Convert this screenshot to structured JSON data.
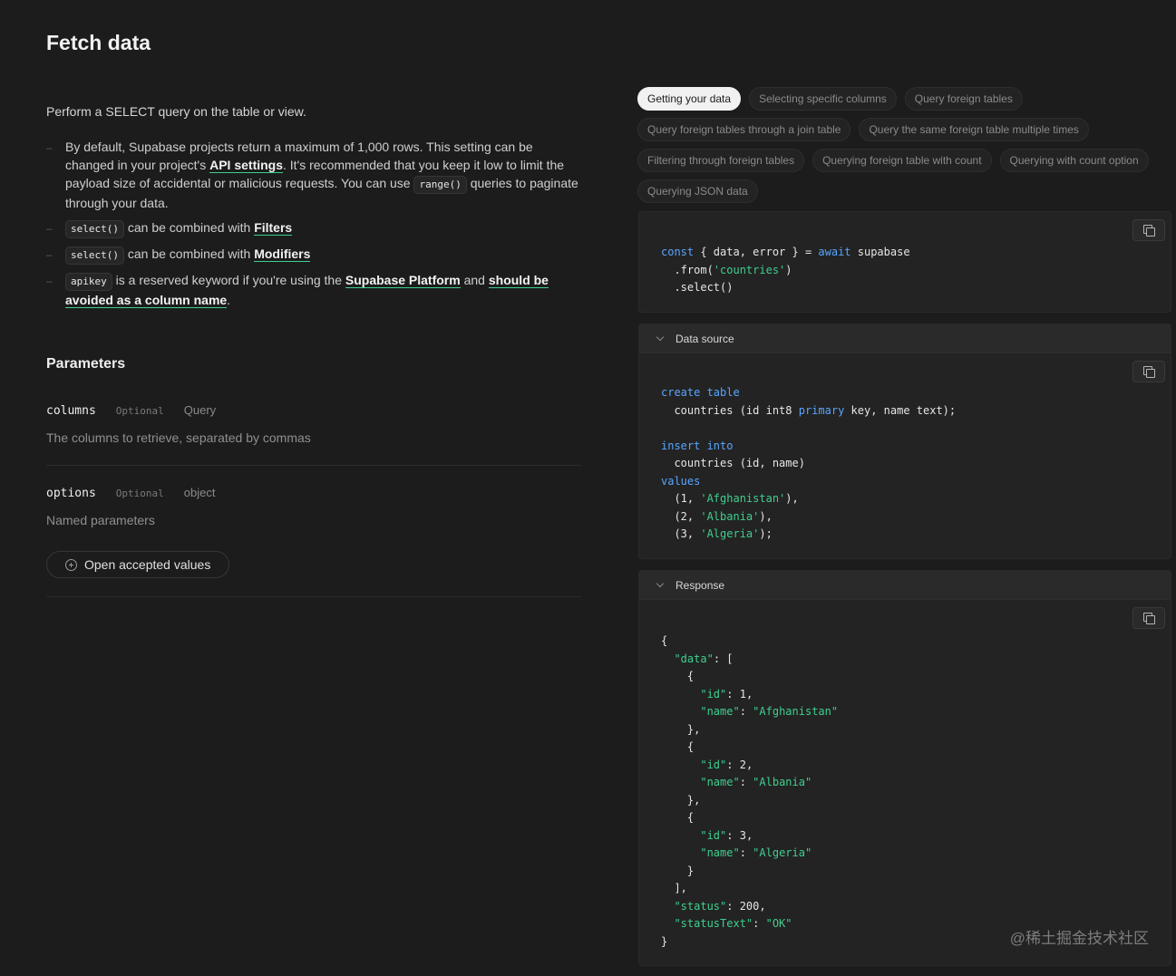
{
  "page": {
    "title": "Fetch data"
  },
  "intro": "Perform a SELECT query on the table or view.",
  "notes": {
    "n1": {
      "text_a": "By default, Supabase projects return a maximum of 1,000 rows. This setting can be changed in your project's ",
      "link_api": "API settings",
      "text_b": ". It's recommended that you keep it low to limit the payload size of accidental or malicious requests. You can use ",
      "code_range": "range()",
      "text_c": " queries to paginate through your data."
    },
    "n2": {
      "code": "select()",
      "text": " can be combined with ",
      "link": "Filters"
    },
    "n3": {
      "code": "select()",
      "text": " can be combined with ",
      "link": "Modifiers"
    },
    "n4": {
      "code": "apikey",
      "text_a": " is a reserved keyword if you're using the ",
      "link_platform": "Supabase Platform",
      "text_b": " and ",
      "link_avoid": "should be avoided as a column name",
      "text_c": "."
    }
  },
  "parameters": {
    "title": "Parameters",
    "columns": {
      "name": "columns",
      "optional": "Optional",
      "type": "Query",
      "desc": "The columns to retrieve, separated by commas"
    },
    "options": {
      "name": "options",
      "optional": "Optional",
      "type": "object",
      "desc": "Named parameters"
    },
    "accepted_button": "Open accepted values"
  },
  "tabs": [
    "Getting your data",
    "Selecting specific columns",
    "Query foreign tables",
    "Query foreign tables through a join table",
    "Query the same foreign table multiple times",
    "Filtering through foreign tables",
    "Querying foreign table with count",
    "Querying with count option",
    "Querying JSON data"
  ],
  "active_tab": "Getting your data",
  "code_example": {
    "l1": {
      "a": "const",
      "b": " { data, error } = ",
      "c": "await",
      "d": " supabase"
    },
    "l2": {
      "a": "  .from(",
      "b": "'countries'",
      "c": ")"
    },
    "l3": "  .select()"
  },
  "data_source": {
    "header": "Data source",
    "s1": {
      "kw": "create table"
    },
    "s2": {
      "a": "  countries (id int8 ",
      "kw": "primary",
      "b": " key, name text);"
    },
    "s4": {
      "kw": "insert into"
    },
    "s5": "  countries (id, name)",
    "s6": {
      "kw": "values"
    },
    "s7": {
      "a": "  (1, ",
      "str": "'Afghanistan'",
      "b": "),"
    },
    "s8": {
      "a": "  (2, ",
      "str": "'Albania'",
      "b": "),"
    },
    "s9": {
      "a": "  (3, ",
      "str": "'Algeria'",
      "b": ");"
    }
  },
  "response": {
    "header": "Response",
    "open_brace": "{",
    "data_key": "\"data\"",
    "data_open": ": [",
    "obj_open": "{",
    "id_key": "\"id\"",
    "name_key": "\"name\"",
    "r1": {
      "id": ": 1,",
      "name": "\"Afghanistan\""
    },
    "r2": {
      "id": ": 2,",
      "name": "\"Albania\""
    },
    "r3": {
      "id": ": 3,",
      "name": "\"Algeria\""
    },
    "obj_close_comma": "},",
    "obj_close": "}",
    "data_close": "],",
    "status_key": "\"status\"",
    "status_val": ": 200,",
    "statustext_key": "\"statusText\"",
    "statustext_val": "\"OK\"",
    "close_brace": "}"
  },
  "watermark": "@稀土掘金技术社区"
}
